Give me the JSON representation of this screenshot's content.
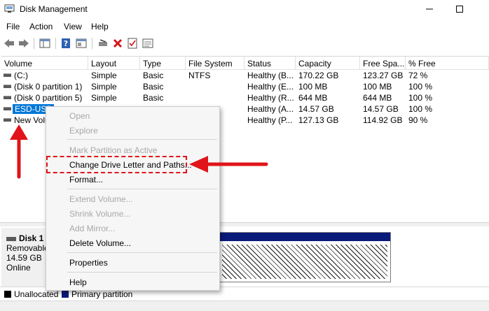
{
  "window": {
    "title": "Disk Management",
    "controls": {
      "minimize": "—",
      "maximize": "☐"
    }
  },
  "menu": [
    "File",
    "Action",
    "View",
    "Help"
  ],
  "toolbar": {
    "icons": [
      "back-arrow-icon",
      "forward-arrow-icon",
      "show-hide-console-tree-icon",
      "help-icon",
      "properties-icon",
      "connect-drive-icon",
      "delete-icon",
      "check-icon",
      "more-icon"
    ]
  },
  "volume_table": {
    "headers": [
      "Volume",
      "Layout",
      "Type",
      "File System",
      "Status",
      "Capacity",
      "Free Spa...",
      "% Free"
    ],
    "rows": [
      {
        "volume": "(C:)",
        "layout": "Simple",
        "type": "Basic",
        "fs": "NTFS",
        "status": "Healthy (B...",
        "capacity": "170.22 GB",
        "free": "123.27 GB",
        "pct": "72 %"
      },
      {
        "volume": "(Disk 0 partition 1)",
        "layout": "Simple",
        "type": "Basic",
        "fs": "",
        "status": "Healthy (E...",
        "capacity": "100 MB",
        "free": "100 MB",
        "pct": "100 %"
      },
      {
        "volume": "(Disk 0 partition 5)",
        "layout": "Simple",
        "type": "Basic",
        "fs": "",
        "status": "Healthy (R...",
        "capacity": "644 MB",
        "free": "644 MB",
        "pct": "100 %"
      },
      {
        "volume": "ESD-USB",
        "layout": "",
        "type": "",
        "fs": "",
        "status": "Healthy (A...",
        "capacity": "14.57 GB",
        "free": "14.57 GB",
        "pct": "100 %"
      },
      {
        "volume": "New Volu",
        "layout": "",
        "type": "",
        "fs": "",
        "status": "Healthy (P...",
        "capacity": "127.13 GB",
        "free": "114.92 GB",
        "pct": "90 %"
      }
    ]
  },
  "disk": {
    "name": "Disk 1",
    "kind": "Removable",
    "size": "14.59 GB",
    "state": "Online"
  },
  "legend": {
    "unallocated": "Unallocated",
    "primary": "Primary partition",
    "unallocated_color": "#000000",
    "primary_color": "#0a1a7a"
  },
  "context_menu": {
    "open": "Open",
    "explore": "Explore",
    "mark_active": "Mark Partition as Active",
    "change_letter": "Change Drive Letter and Paths...",
    "format": "Format...",
    "extend": "Extend Volume...",
    "shrink": "Shrink Volume...",
    "add_mirror": "Add Mirror...",
    "delete": "Delete Volume...",
    "properties": "Properties",
    "help": "Help"
  },
  "colors": {
    "selection": "#0078d7",
    "annotation_red": "#e0141a"
  }
}
